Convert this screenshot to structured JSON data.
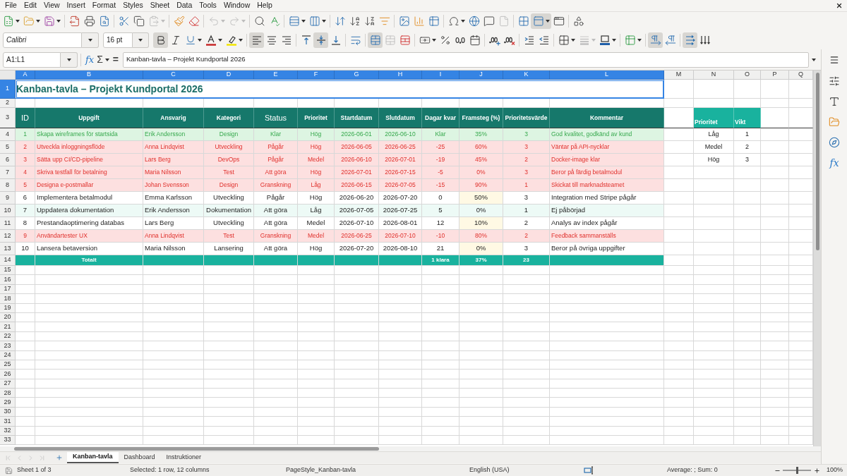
{
  "menu_bar": {
    "items": [
      "File",
      "Edit",
      "View",
      "Insert",
      "Format",
      "Styles",
      "Sheet",
      "Data",
      "Tools",
      "Window",
      "Help"
    ]
  },
  "standard_toolbar": {
    "paste": {
      "disabled": true
    },
    "undo": {
      "disabled": true
    },
    "redo": {
      "disabled": true
    },
    "header_footer": {
      "disabled": true
    },
    "freeze": {
      "pressed": true
    }
  },
  "formatting_toolbar": {
    "font_name": "Calibri",
    "font_size": "16 pt",
    "bold": {
      "pressed": true
    },
    "italic": {
      "pressed": false
    },
    "underline": {
      "pressed": false
    },
    "align_left": {
      "pressed": true
    },
    "align_center": {
      "pressed": false
    },
    "align_right": {
      "pressed": false
    },
    "align_top": {
      "pressed": false
    },
    "align_middle": {
      "pressed": true
    },
    "align_bottom": {
      "pressed": false
    },
    "merge_center": {
      "pressed": true
    },
    "merge": {
      "disabled": true
    },
    "border_style": {
      "disabled": true
    },
    "left_to_right": {
      "pressed": true
    },
    "right_to_left": {
      "pressed": false
    },
    "text_horizontal": {
      "pressed": true
    },
    "text_vertical": {
      "pressed": false
    }
  },
  "formula_bar": {
    "name_box": "A1:L1",
    "function_wizard": "fx",
    "sum": "Σ",
    "equals": "=",
    "content": "Kanban-tavla – Projekt Kundportal 2026"
  },
  "sheet": {
    "columns": [
      {
        "label": "A",
        "selected": true
      },
      {
        "label": "B",
        "selected": true
      },
      {
        "label": "C",
        "selected": true
      },
      {
        "label": "D",
        "selected": true
      },
      {
        "label": "E",
        "selected": true
      },
      {
        "label": "F",
        "selected": true
      },
      {
        "label": "G",
        "selected": true
      },
      {
        "label": "H",
        "selected": true
      },
      {
        "label": "I",
        "selected": true
      },
      {
        "label": "J",
        "selected": true
      },
      {
        "label": "K",
        "selected": true
      },
      {
        "label": "L",
        "selected": true
      },
      {
        "label": "M",
        "selected": false
      },
      {
        "label": "N",
        "selected": false
      },
      {
        "label": "O",
        "selected": false
      },
      {
        "label": "P",
        "selected": false
      },
      {
        "label": "Q",
        "selected": false
      }
    ],
    "rows": [
      {
        "label": "1",
        "selected": true
      },
      {
        "label": "2",
        "selected": false
      },
      {
        "label": "3",
        "selected": false
      },
      {
        "label": "4",
        "selected": false
      },
      {
        "label": "5",
        "selected": false
      },
      {
        "label": "6",
        "selected": false
      },
      {
        "label": "7",
        "selected": false
      },
      {
        "label": "8",
        "selected": false
      },
      {
        "label": "9",
        "selected": false
      },
      {
        "label": "10",
        "selected": false
      },
      {
        "label": "11",
        "selected": false
      },
      {
        "label": "12",
        "selected": false
      },
      {
        "label": "13",
        "selected": false
      },
      {
        "label": "14",
        "selected": false
      },
      {
        "label": "15",
        "selected": false
      },
      {
        "label": "16",
        "selected": false
      },
      {
        "label": "17",
        "selected": false
      },
      {
        "label": "18",
        "selected": false
      },
      {
        "label": "19",
        "selected": false
      },
      {
        "label": "20",
        "selected": false
      },
      {
        "label": "21",
        "selected": false
      },
      {
        "label": "22",
        "selected": false
      },
      {
        "label": "23",
        "selected": false
      },
      {
        "label": "24",
        "selected": false
      },
      {
        "label": "25",
        "selected": false
      },
      {
        "label": "26",
        "selected": false
      },
      {
        "label": "27",
        "selected": false
      },
      {
        "label": "28",
        "selected": false
      },
      {
        "label": "29",
        "selected": false
      },
      {
        "label": "30",
        "selected": false
      },
      {
        "label": "31",
        "selected": false
      },
      {
        "label": "32",
        "selected": false
      },
      {
        "label": "33",
        "selected": false
      }
    ],
    "title": "Kanban-tavla – Projekt Kundportal 2026",
    "table": {
      "columns": [
        {
          "label": "ID",
          "large": true
        },
        {
          "label": "Uppgift",
          "large": false
        },
        {
          "label": "Ansvarig",
          "large": false
        },
        {
          "label": "Kategori",
          "large": false
        },
        {
          "label": "Status",
          "large": true
        },
        {
          "label": "Prioritet",
          "large": false
        },
        {
          "label": "Startdatum",
          "large": false
        },
        {
          "label": "Slutdatum",
          "large": false
        },
        {
          "label": "Dagar kvar",
          "large": false
        },
        {
          "label": "Framsteg (%)",
          "large": false
        },
        {
          "label": "Prioritetsvärde",
          "large": false
        },
        {
          "label": "Kommentar",
          "large": false
        }
      ],
      "rows": [
        {
          "kind": "done",
          "cells": [
            "1",
            "Skapa wireframes för startsida",
            "Erik Andersson",
            "Design",
            "Klar",
            "Hög",
            "2026-06-01",
            "2026-06-10",
            "Klar",
            "35%",
            "3",
            "God kvalitet, godkänd av kund"
          ]
        },
        {
          "kind": "overdue",
          "cells": [
            "2",
            "Utveckla inloggningsflöde",
            "Anna Lindqvist",
            "Utveckling",
            "Pågår",
            "Hög",
            "2026-06-05",
            "2026-06-25",
            "-25",
            "60%",
            "3",
            "Väntar på API-nycklar"
          ]
        },
        {
          "kind": "overdue",
          "cells": [
            "3",
            "Sätta upp CI/CD-pipeline",
            "Lars Berg",
            "DevOps",
            "Pågår",
            "Medel",
            "2026-06-10",
            "2026-07-01",
            "-19",
            "45%",
            "2",
            "Docker-image klar"
          ]
        },
        {
          "kind": "overdue",
          "cells": [
            "4",
            "Skriva testfall för betalning",
            "Maria Nilsson",
            "Test",
            "Att göra",
            "Hög",
            "2026-07-01",
            "2026-07-15",
            "-5",
            "0%",
            "3",
            "Beror på färdig betalmodul"
          ]
        },
        {
          "kind": "overdue",
          "cells": [
            "5",
            "Designa e-postmallar",
            "Johan Svensson",
            "Design",
            "Granskning",
            "Låg",
            "2026-06-15",
            "2026-07-05",
            "-15",
            "90%",
            "1",
            "Skickat till marknadsteamet"
          ]
        },
        {
          "kind": "plain",
          "cells": [
            "6",
            "Implementera betalmodul",
            "Emma Karlsson",
            "Utveckling",
            "Pågår",
            "Hög",
            "2026-06-20",
            "2026-07-20",
            "0",
            "50%",
            "3",
            "Integration med Stripe pågår"
          ]
        },
        {
          "kind": "banded",
          "cells": [
            "7",
            "Uppdatera dokumentation",
            "Erik Andersson",
            "Dokumentation",
            "Att göra",
            "Låg",
            "2026-07-05",
            "2026-07-25",
            "5",
            "0%",
            "1",
            "Ej påbörjad"
          ]
        },
        {
          "kind": "plain",
          "cells": [
            "8",
            "Prestandaoptimering databas",
            "Lars Berg",
            "Utveckling",
            "Att göra",
            "Medel",
            "2026-07-10",
            "2026-08-01",
            "12",
            "10%",
            "2",
            "Analys av index pågår"
          ]
        },
        {
          "kind": "overdue",
          "cells": [
            "9",
            "Användartester UX",
            "Anna Lindqvist",
            "Test",
            "Granskning",
            "Medel",
            "2026-06-25",
            "2026-07-10",
            "-10",
            "80%",
            "2",
            "Feedback sammanställs"
          ]
        },
        {
          "kind": "plain",
          "cells": [
            "10",
            "Lansera betaversion",
            "Maria Nilsson",
            "Lansering",
            "Att göra",
            "Hög",
            "2026-07-20",
            "2026-08-10",
            "21",
            "0%",
            "3",
            "Beror på övriga uppgifter"
          ]
        }
      ],
      "total": {
        "label": "Totalt",
        "days_left": "1 klara",
        "progress": "37%",
        "priority_sum": "23"
      }
    },
    "lookup_table": {
      "columns": [
        "Prioritet",
        "Vikt"
      ],
      "rows": [
        [
          "Låg",
          "1"
        ],
        [
          "Medel",
          "2"
        ],
        [
          "Hög",
          "3"
        ]
      ]
    }
  },
  "sidebar": {
    "functions": "fx"
  },
  "sheet_tabs": [
    {
      "label": "Kanban-tavla",
      "selected": true
    },
    {
      "label": "Dashboard",
      "selected": false
    },
    {
      "label": "Instruktioner",
      "selected": false
    }
  ],
  "status_bar": {
    "sheet_position": "Sheet 1 of 3",
    "selection": "Selected: 1 row, 12 columns",
    "page_style": "PageStyle_Kanban-tavla",
    "language": "English (USA)",
    "summary": "Average: ; Sum: 0",
    "zoom_slider": {
      "level": 0.5
    },
    "zoom": "100%"
  }
}
